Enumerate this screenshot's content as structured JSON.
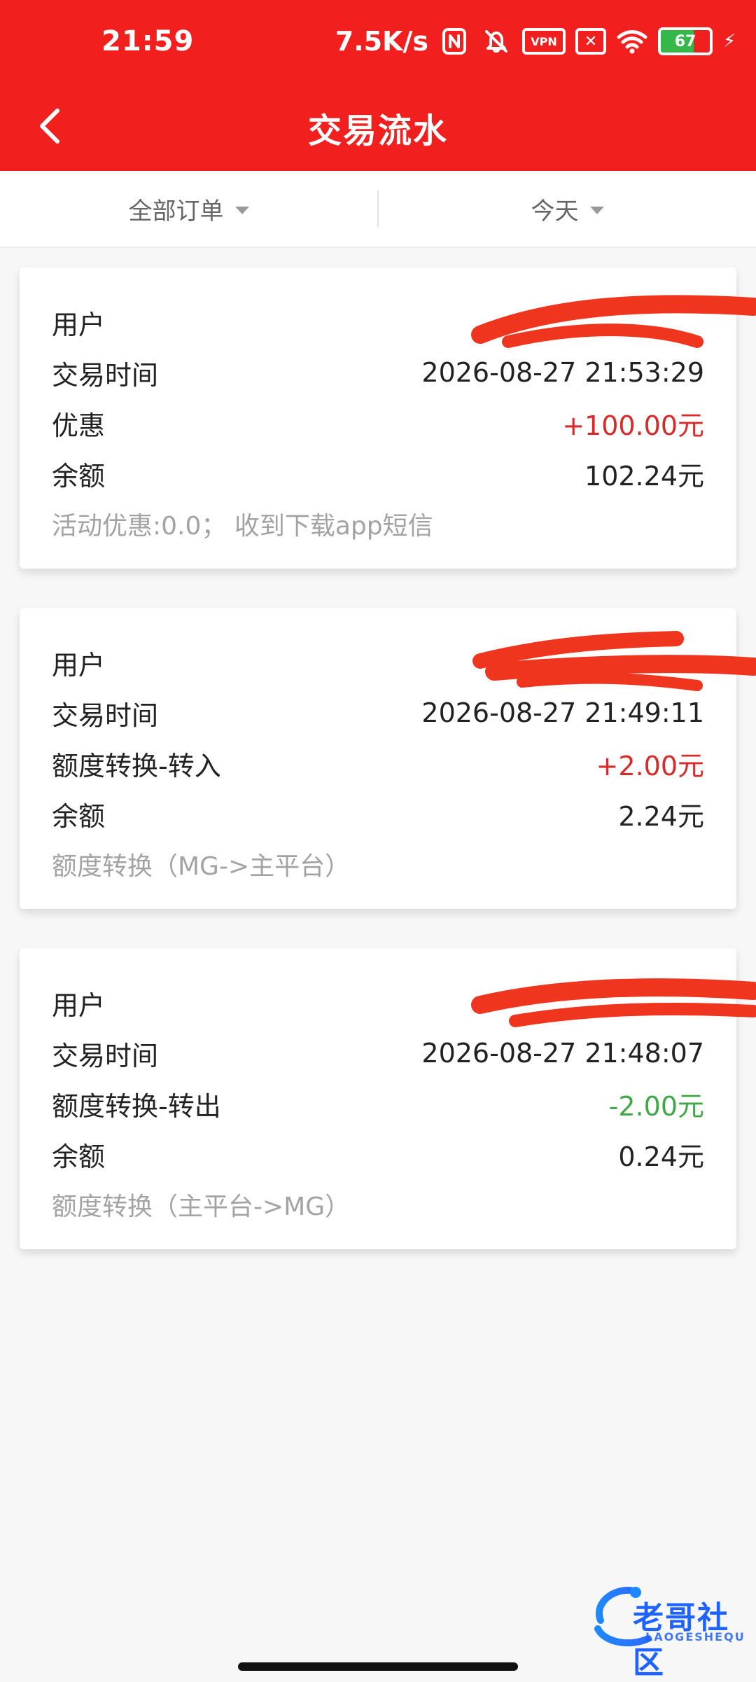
{
  "status": {
    "time": "21:59",
    "speed": "7.5K/s",
    "battery": 67,
    "battery_text": "67",
    "icons": [
      "nfc-icon",
      "mute-icon",
      "vpn-icon",
      "x-sim-icon",
      "wifi-icon",
      "battery-icon",
      "charging-bolt-icon"
    ],
    "vpn_text": "VPN"
  },
  "appbar": {
    "title": "交易流水",
    "back_icon": "chevron-left-icon",
    "bg_color": "#f21f1f"
  },
  "filters": [
    {
      "label": "全部订单",
      "icon": "caret-down-icon"
    },
    {
      "label": "今天",
      "icon": "caret-down-icon"
    }
  ],
  "transactions": [
    {
      "user_label": "用户",
      "user_value": "",
      "time_label": "交易时间",
      "time_value": "2026-08-27 21:53:29",
      "type_label": "优惠",
      "amount": "+100.00元",
      "amount_color": "#d92a2a",
      "balance_label": "余额",
      "balance": "102.24元",
      "note": "活动优惠:0.0；  收到下载app短信"
    },
    {
      "user_label": "用户",
      "user_value": "",
      "time_label": "交易时间",
      "time_value": "2026-08-27 21:49:11",
      "type_label": "额度转换-转入",
      "amount": "+2.00元",
      "amount_color": "#d92a2a",
      "balance_label": "余额",
      "balance": "2.24元",
      "note": "额度转换（MG->主平台）"
    },
    {
      "user_label": "用户",
      "user_value": "",
      "time_label": "交易时间",
      "time_value": "2026-08-27 21:48:07",
      "type_label": "额度转换-转出",
      "amount": "-2.00元",
      "amount_color": "#41a84a",
      "balance_label": "余额",
      "balance": "0.24元",
      "note": "额度转换（主平台->MG）"
    }
  ],
  "watermark": {
    "text": "老哥社区",
    "sub": "LAOGESHEQU",
    "icon": "dragon-logo-icon"
  }
}
